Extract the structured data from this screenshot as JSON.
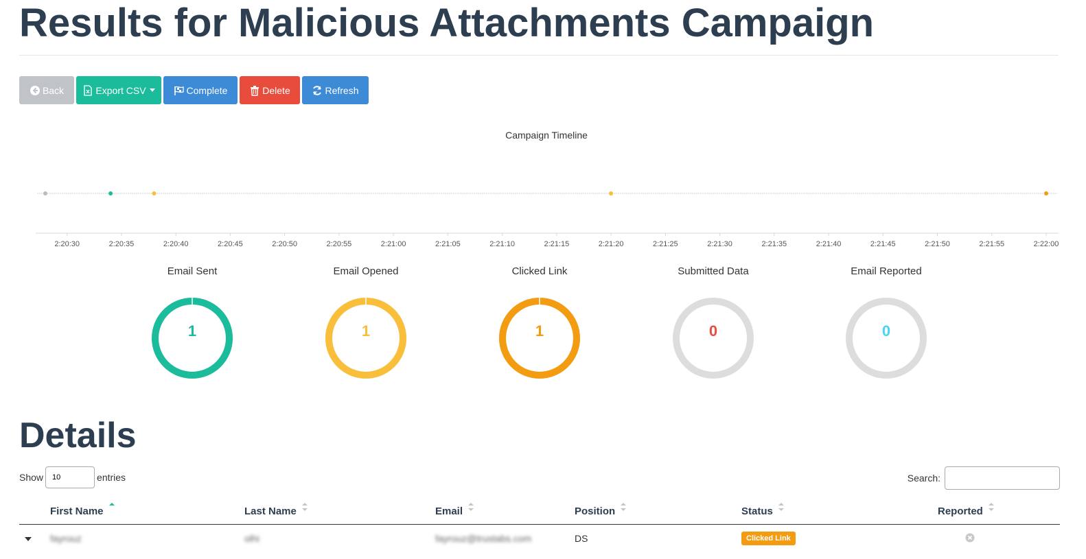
{
  "page": {
    "title": "Results for Malicious Attachments Campaign"
  },
  "toolbar": {
    "back_label": "Back",
    "export_label": "Export CSV",
    "complete_label": "Complete",
    "delete_label": "Delete",
    "refresh_label": "Refresh"
  },
  "chart_data": {
    "type": "scatter",
    "title": "Campaign Timeline",
    "x_ticks": [
      "2:20:30",
      "2:20:35",
      "2:20:40",
      "2:20:45",
      "2:20:50",
      "2:20:55",
      "2:21:00",
      "2:21:05",
      "2:21:10",
      "2:21:15",
      "2:21:20",
      "2:21:25",
      "2:21:30",
      "2:21:35",
      "2:21:40",
      "2:21:45",
      "2:21:50",
      "2:21:55",
      "2:22:00"
    ],
    "xlim": [
      "2:20:28",
      "2:22:00"
    ],
    "series": [
      {
        "values": [
          {
            "x": "2:20:28",
            "y": 1
          }
        ],
        "color": "#bbbbbb"
      },
      {
        "values": [
          {
            "x": "2:20:34",
            "y": 1
          }
        ],
        "color": "#1abc9c"
      },
      {
        "values": [
          {
            "x": "2:20:38",
            "y": 1
          }
        ],
        "color": "#f9bf3b"
      },
      {
        "values": [
          {
            "x": "2:21:20",
            "y": 1
          }
        ],
        "color": "#f9bf3b"
      },
      {
        "values": [
          {
            "x": "2:22:00",
            "y": 1
          }
        ],
        "color": "#f39c12"
      }
    ],
    "grid": false
  },
  "stats": [
    {
      "label": "Email Sent",
      "value": "1",
      "fraction": 1,
      "color": "#1abc9c"
    },
    {
      "label": "Email Opened",
      "value": "1",
      "fraction": 1,
      "color": "#f9bf3b"
    },
    {
      "label": "Clicked Link",
      "value": "1",
      "fraction": 1,
      "color": "#f39c12"
    },
    {
      "label": "Submitted Data",
      "value": "0",
      "fraction": 0,
      "color": "#e74c3c"
    },
    {
      "label": "Email Reported",
      "value": "0",
      "fraction": 0,
      "color": "#45d6ef"
    }
  ],
  "details": {
    "heading": "Details",
    "show_label": "Show",
    "entries_value": "10",
    "entries_label": "entries",
    "search_label": "Search:",
    "columns": [
      "First Name",
      "Last Name",
      "Email",
      "Position",
      "Status",
      "Reported"
    ],
    "rows": [
      {
        "first_name": "fayrouz",
        "last_name": "olhi",
        "email": "fayrouz@trustabs.com",
        "position": "DS",
        "status": "Clicked Link"
      }
    ]
  }
}
